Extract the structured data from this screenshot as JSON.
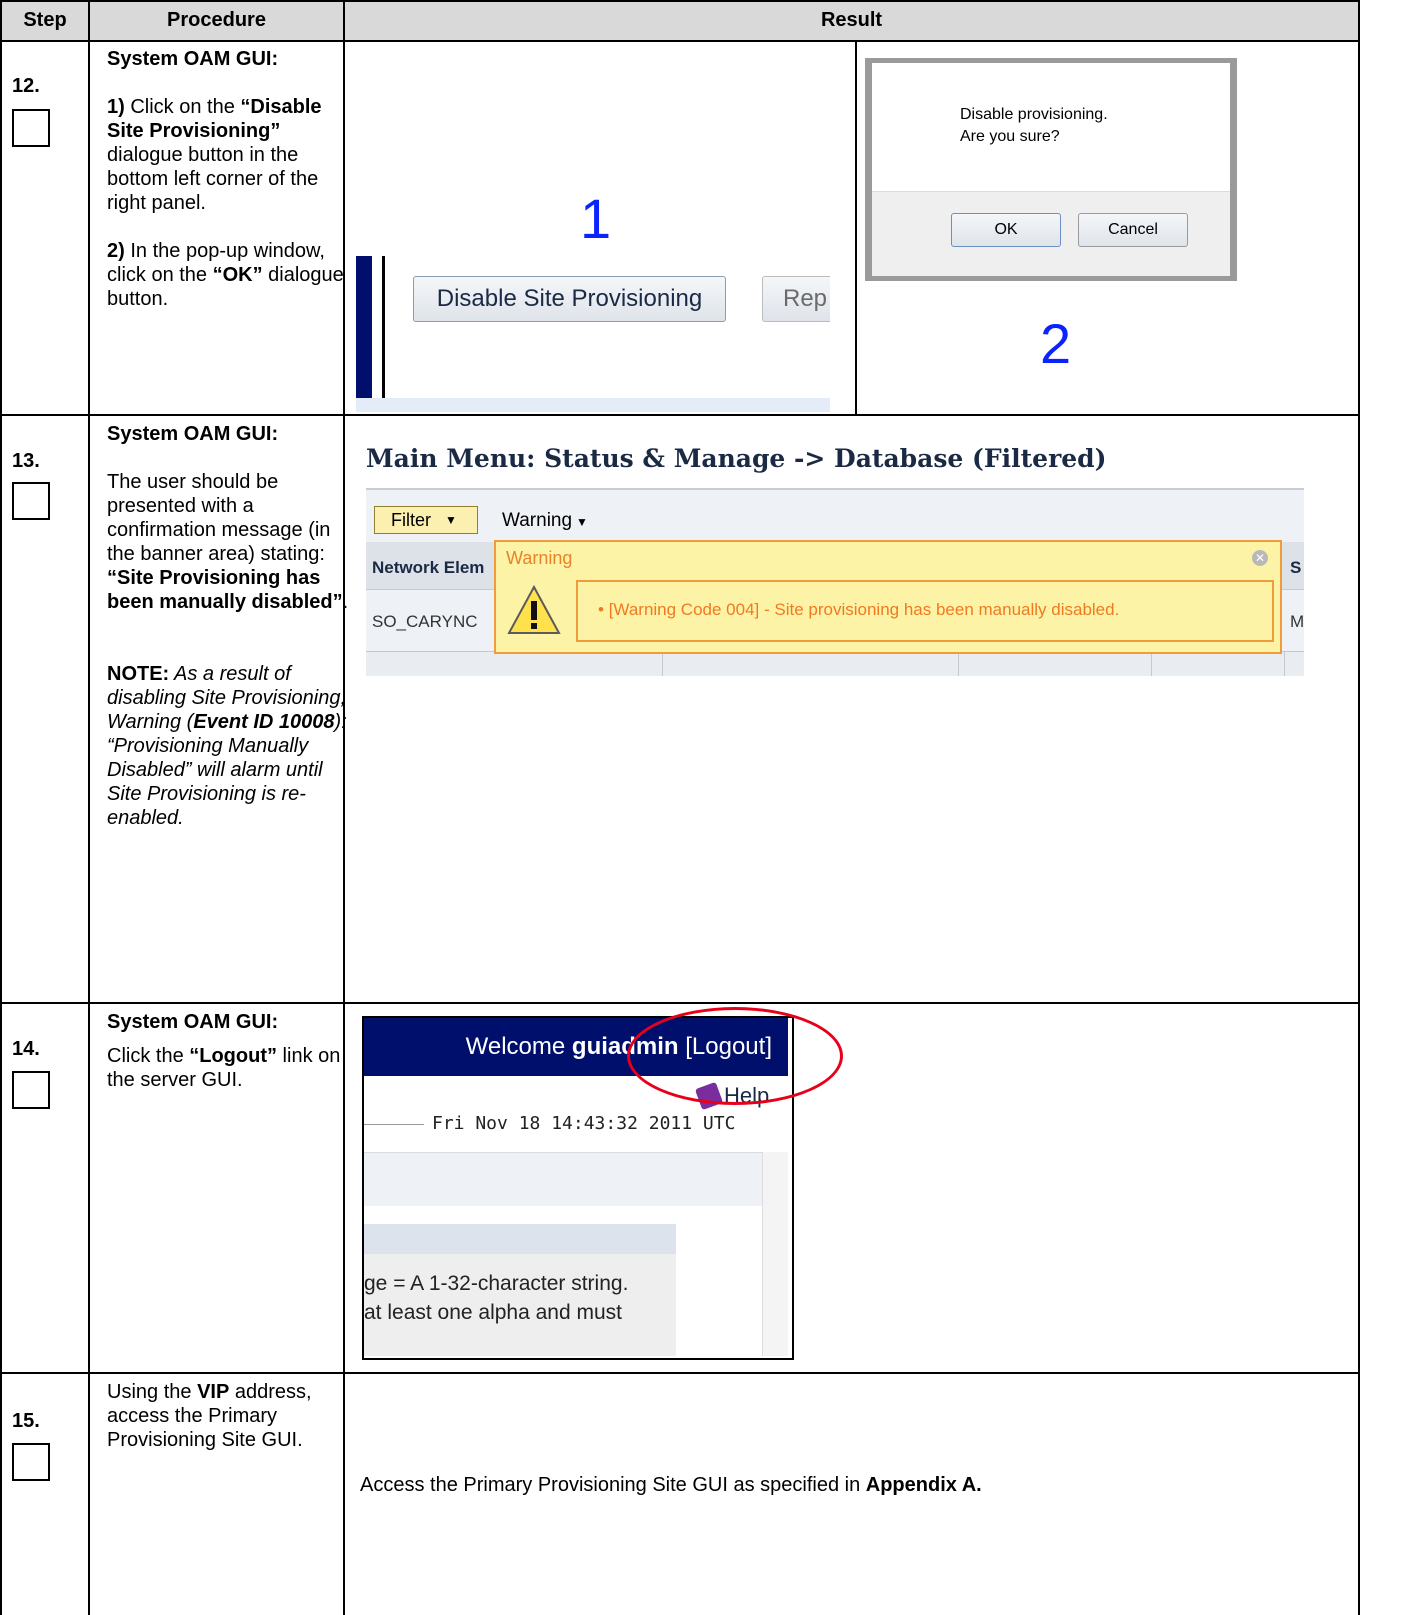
{
  "header": {
    "step": "Step",
    "procedure": "Procedure",
    "result": "Result"
  },
  "step12": {
    "number": "12.",
    "title": "System OAM GUI:",
    "p1_num": "1)",
    "p1_text": " Click on the ",
    "p1_bold": "“Disable Site Provisioning”",
    "p1_rest": " dialogue button in the bottom left corner of the right panel.",
    "p2_num": "2)",
    "p2_text": " In the pop-up window, click on the ",
    "p2_bold": "“OK”",
    "p2_rest": " dialogue button.",
    "img1_number": "1",
    "img1_button": "Disable Site Provisioning",
    "img1_button2": "Rep",
    "img2_number": "2",
    "dialog_line1": "Disable provisioning.",
    "dialog_line2": "Are you sure?",
    "dialog_ok": "OK",
    "dialog_cancel": "Cancel"
  },
  "step13": {
    "number": "13.",
    "title": "System OAM GUI:",
    "text": "The user should be presented with a confirmation message (in the banner area) stating: ",
    "bold": "“Site Provisioning has been manually disabled”",
    "period": ".",
    "note_label": "NOTE:",
    "note_a": " As a result of disabling Site Provisioning, Warning  (",
    "note_event": "Event ID 10008",
    "note_b": "): “Provisioning Manually Disabled” will alarm until Site Provisioning is re-enabled.",
    "page_title": "Main Menu: Status & Manage -> Database (Filtered)",
    "filter_label": "Filter",
    "warning_menu": "Warning",
    "col_network": "Network Elem",
    "col_s": "S",
    "row_cell": "SO_CARYNC",
    "row_m": "M",
    "warning_title": "Warning",
    "warning_message": "[Warning Code 004] - Site provisioning has been manually disabled."
  },
  "step14": {
    "number": "14.",
    "title": "System OAM GUI:",
    "text": "Click the ",
    "bold": "“Logout”",
    "rest": " link on the server GUI.",
    "welcome": "Welcome ",
    "user": "guiadmin",
    "logout": "[Logout]",
    "help": "Help",
    "datetime": "Fri Nov 18 14:43:32 2011 UTC",
    "line1": "ge = A 1-32-character string.",
    "line2": "at least one alpha and must"
  },
  "step15": {
    "number": "15.",
    "text1": "Using the ",
    "vip": "VIP",
    "text2": " address, access the Primary Provisioning Site GUI.",
    "result_text": "Access the Primary Provisioning Site GUI as specified in ",
    "result_bold": "Appendix A."
  },
  "colors": {
    "header_bg": "#d9d9d9",
    "dark_navy": "#000f6b",
    "warning_yellow": "#fdf3a6",
    "warning_orange": "#f19b39",
    "annotation_blue": "#0b24ff",
    "highlight_red": "#e8001a"
  }
}
